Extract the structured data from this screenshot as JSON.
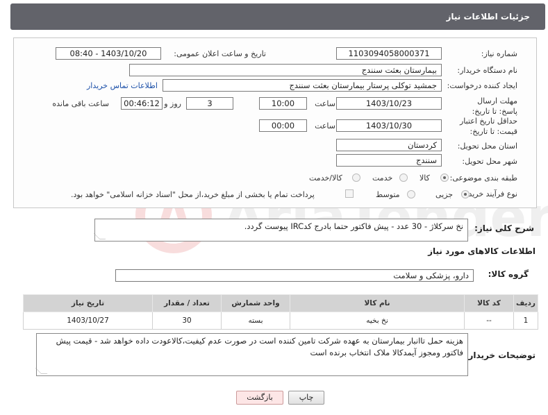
{
  "header": {
    "title": "جزئیات اطلاعات نیاز"
  },
  "fields": {
    "need_number_label": "شماره نیاز:",
    "need_number": "1103094058000371",
    "announce_label": "تاریخ و ساعت اعلان عمومی:",
    "announce_value": "1403/10/20 - 08:40",
    "buyer_org_label": "نام دستگاه خریدار:",
    "buyer_org": "بیمارستان بعثت سنندج",
    "creator_label": "ایجاد کننده درخواست:",
    "creator": "جمشید  توکلی پرستار بیمارستان بعثت سنندج",
    "contact_link": "اطلاعات تماس خریدار",
    "reply_deadline_label": "مهلت ارسال پاسخ: تا تاریخ:",
    "reply_date": "1403/10/23",
    "time_label": "ساعت",
    "reply_time": "10:00",
    "days_value": "3",
    "days_label": "روز و",
    "remaining_time": "00:46:12",
    "remaining_label": "ساعت باقی مانده",
    "validity_label": "حداقل تاریخ اعتبار قیمت: تا تاریخ:",
    "validity_date": "1403/10/30",
    "validity_time": "00:00",
    "province_label": "استان محل تحویل:",
    "province": "کردستان",
    "city_label": "شهر محل تحویل:",
    "city": "سنندج",
    "category_label": "طبقه بندی موضوعی:",
    "category_options": [
      "کالا",
      "خدمت",
      "کالا/خدمت"
    ],
    "process_label": "نوع فرآیند خرید :",
    "process_options": [
      "جزیی",
      "متوسط"
    ],
    "payment_note": "پرداخت تمام یا بخشی از مبلغ خرید،از محل \"اسناد خزانه اسلامی\" خواهد بود."
  },
  "summary": {
    "label": "شرح کلی نیاز:",
    "text": "نخ سرکلاژ - 30 عدد - پیش فاکتور حتما بادرج کدIRC پیوست گردد."
  },
  "goods": {
    "section_title": "اطلاعات کالاهای مورد نیاز",
    "group_label": "گروه کالا:",
    "group_value": "دارو، پزشکی و سلامت",
    "columns": [
      "ردیف",
      "کد کالا",
      "نام کالا",
      "واحد شمارش",
      "تعداد / مقدار",
      "تاریخ نیاز"
    ],
    "rows": [
      {
        "row": "1",
        "code": "--",
        "name": "نخ بخیه",
        "unit": "بسته",
        "qty": "30",
        "date": "1403/10/27"
      }
    ]
  },
  "buyer_notes": {
    "label": "توضیحات خریدار:",
    "text": "هزینه حمل تاانبار بیمارستان به عهده شرکت تامین کننده است در صورت عدم کیفیت،کالاعودت داده خواهد شد - قیمت پیش فاکتور ومجوز آیمدکالا ملاک انتخاب برنده است"
  },
  "buttons": {
    "print": "چاپ",
    "back": "بازگشت"
  },
  "colors": {
    "header_bg": "#62636a",
    "link": "#1b4fa8",
    "table_header": "#d3d3d3"
  }
}
